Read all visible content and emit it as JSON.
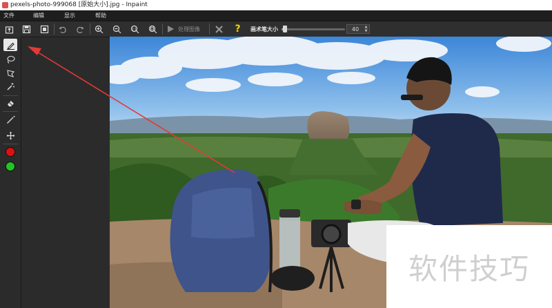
{
  "window": {
    "title": "pexels-photo-999068 [原始大小].jpg - Inpaint"
  },
  "menu": {
    "file": "文件",
    "edit": "编辑",
    "view": "显示",
    "help": "帮助"
  },
  "toolbar": {
    "process_label": "处理图像",
    "help_glyph": "?",
    "brush_label": "画术笔大小",
    "brush_size_value": "40",
    "brush_size_fraction": 0.05
  },
  "icons": {
    "toolbar": [
      "open-icon",
      "save-icon",
      "save-as-icon",
      "undo-icon",
      "redo-icon",
      "zoom-in-icon",
      "zoom-out-icon",
      "zoom-actual-icon",
      "zoom-fit-icon",
      "play-icon",
      "close-icon",
      "help-icon"
    ],
    "sidebar": [
      "marker-icon",
      "lasso-icon",
      "polygon-lasso-icon",
      "magic-wand-icon",
      "eraser-icon",
      "line-icon",
      "move-icon"
    ]
  },
  "colors": {
    "mark_color": "#e01010",
    "keep_color": "#1ec81e",
    "accent_question": "#f5d000",
    "annotation_arrow": "#e53935"
  },
  "watermark": {
    "text": "软件技巧"
  }
}
